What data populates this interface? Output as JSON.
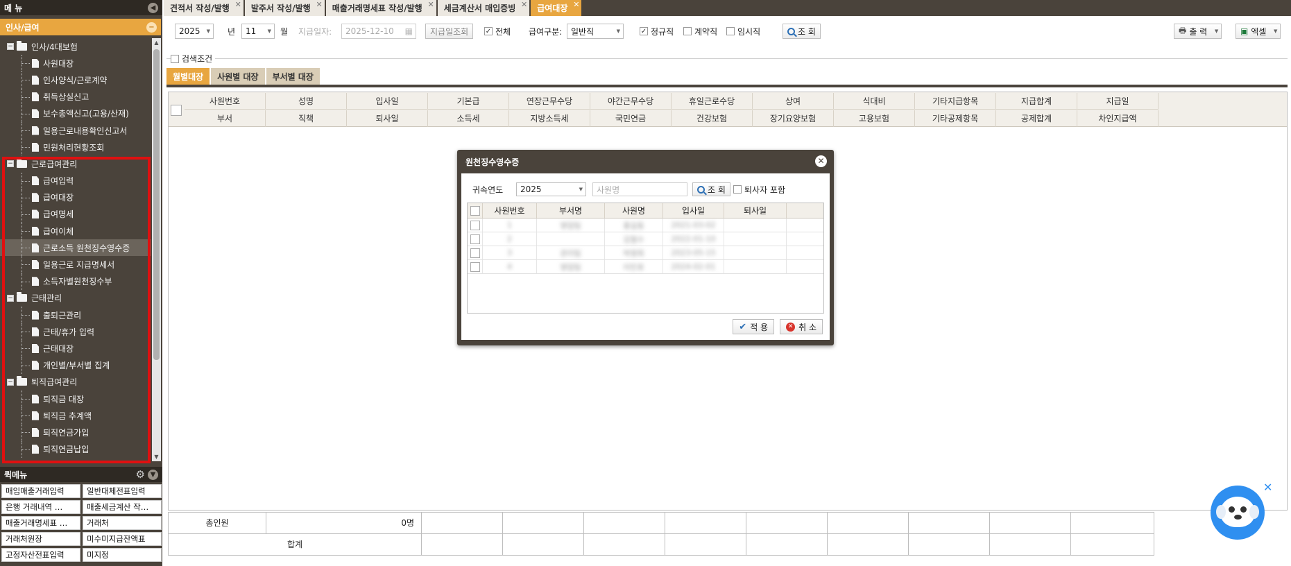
{
  "sidebar": {
    "menu_title": "메 뉴",
    "section_title": "인사/급여",
    "tree": [
      {
        "type": "folder",
        "label": "인사/4대보험"
      },
      {
        "type": "leaf",
        "label": "사원대장"
      },
      {
        "type": "leaf",
        "label": "인사양식/근로계약"
      },
      {
        "type": "leaf",
        "label": "취득상실신고"
      },
      {
        "type": "leaf",
        "label": "보수총액신고(고용/산재)"
      },
      {
        "type": "leaf",
        "label": "일용근로내용확인신고서"
      },
      {
        "type": "leaf",
        "label": "민원처리현황조회"
      },
      {
        "type": "folder",
        "label": "근로급여관리"
      },
      {
        "type": "leaf",
        "label": "급여입력"
      },
      {
        "type": "leaf",
        "label": "급여대장"
      },
      {
        "type": "leaf",
        "label": "급여명세"
      },
      {
        "type": "leaf",
        "label": "급여이체"
      },
      {
        "type": "leaf",
        "label": "근로소득 원천징수영수증",
        "selected": true
      },
      {
        "type": "leaf",
        "label": "일용근로 지급명세서"
      },
      {
        "type": "leaf",
        "label": "소득자별원천징수부"
      },
      {
        "type": "folder",
        "label": "근태관리"
      },
      {
        "type": "leaf",
        "label": "출퇴근관리"
      },
      {
        "type": "leaf",
        "label": "근태/휴가 입력"
      },
      {
        "type": "leaf",
        "label": "근태대장"
      },
      {
        "type": "leaf",
        "label": "개인별/부서별 집계"
      },
      {
        "type": "folder",
        "label": "퇴직급여관리"
      },
      {
        "type": "leaf",
        "label": "퇴직금 대장"
      },
      {
        "type": "leaf",
        "label": "퇴직금 추계액"
      },
      {
        "type": "leaf",
        "label": "퇴직연금가입"
      },
      {
        "type": "leaf",
        "label": "퇴직연금납입"
      }
    ],
    "quick_title": "퀵메뉴",
    "quick_items": [
      "매입매출거래입력",
      "일반대체전표입력",
      "은행 거래내역 …",
      "매출세금계산 작…",
      "매출거래명세표 …",
      "거래처",
      "거래처원장",
      "미수미지급잔액표",
      "고정자산전표입력",
      "미지정"
    ]
  },
  "tabs": [
    {
      "label": "견적서 작성/발행",
      "active": false
    },
    {
      "label": "발주서 작성/발행",
      "active": false
    },
    {
      "label": "매출거래명세표 작성/발행",
      "active": false
    },
    {
      "label": "세금계산서 매입증빙",
      "active": false
    },
    {
      "label": "급여대장",
      "active": true
    }
  ],
  "toolbar": {
    "year": "2025",
    "year_unit": "년",
    "month": "11",
    "month_unit": "월",
    "pay_date_label": "지급일자:",
    "pay_date": "2025-12-10",
    "pay_date_search": "지급일조회",
    "all_label": "전체",
    "pay_type_label": "급여구분:",
    "pay_type": "일반직",
    "regular_label": "정규직",
    "contract_label": "계약직",
    "temp_label": "임시직",
    "search_btn": "조 회",
    "print_btn": "출 력",
    "excel_btn": "엑셀"
  },
  "search_condition": "검색조건",
  "subtabs": [
    {
      "label": "월별대장",
      "active": true
    },
    {
      "label": "사원별 대장",
      "active": false
    },
    {
      "label": "부서별 대장",
      "active": false
    }
  ],
  "grid": {
    "header_row1": [
      "사원번호",
      "성명",
      "입사일",
      "기본급",
      "연장근무수당",
      "야간근무수당",
      "휴일근로수당",
      "상여",
      "식대비",
      "기타지급항목",
      "지급합계",
      "지급일"
    ],
    "header_row2": [
      "부서",
      "직책",
      "퇴사일",
      "소득세",
      "지방소득세",
      "국민연금",
      "건강보험",
      "장기요양보험",
      "고용보험",
      "기타공제항목",
      "공제합계",
      "차인지급액"
    ]
  },
  "footer": {
    "total_people_label": "총인원",
    "total_people_value": "0명",
    "sum_label": "합계"
  },
  "modal": {
    "title": "원천징수영수증",
    "year_label": "귀속연도",
    "year": "2025",
    "name_placeholder": "사원명",
    "search_btn": "조 회",
    "include_retired": "퇴사자 포함",
    "columns": [
      "사원번호",
      "부서명",
      "사원명",
      "입사일",
      "퇴사일"
    ],
    "rows": [
      [
        "1",
        "영업팀",
        "홍길동",
        "2021-03-02",
        ""
      ],
      [
        "2",
        "",
        "김철수",
        "2022-01-10",
        ""
      ],
      [
        "3",
        "관리팀",
        "박영희",
        "2023-05-15",
        ""
      ],
      [
        "4",
        "영업팀",
        "이민호",
        "2024-02-01",
        ""
      ]
    ],
    "apply_btn": "적 용",
    "cancel_btn": "취 소"
  }
}
